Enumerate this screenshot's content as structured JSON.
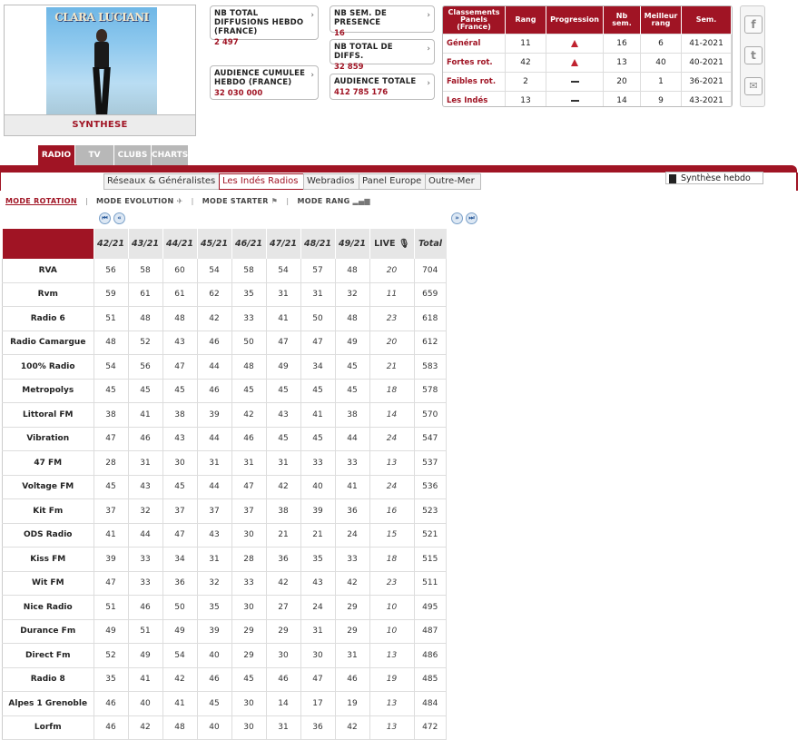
{
  "cover": {
    "artist_text": "CLARA LUCIANI",
    "synthese_label": "SYNTHESE"
  },
  "stats": {
    "nb_total_diffusions": {
      "label": "NB TOTAL DIFFUSIONS HEBDO (FRANCE)",
      "value": "2 497"
    },
    "nb_sem_presence": {
      "label": "NB SEM. DE PRESENCE",
      "value": "16"
    },
    "nb_total_diffs": {
      "label": "NB TOTAL DE DIFFS.",
      "value": "32 859"
    },
    "audience_cumulee": {
      "label": "AUDIENCE CUMULEE HEBDO (FRANCE)",
      "value": "32 030 000"
    },
    "audience_totale": {
      "label": "AUDIENCE TOTALE",
      "value": "412 785 176"
    }
  },
  "classements": {
    "headers": [
      "Classements Panels (France)",
      "Rang",
      "Progression",
      "Nb sem.",
      "Meilleur rang",
      "Sem."
    ],
    "rows": [
      {
        "label": "Général",
        "rang": "11",
        "progression": "up",
        "nb_sem": "16",
        "meilleur": "6",
        "sem": "41-2021"
      },
      {
        "label": "Fortes rot.",
        "rang": "42",
        "progression": "up",
        "nb_sem": "13",
        "meilleur": "40",
        "sem": "40-2021"
      },
      {
        "label": "Faibles rot.",
        "rang": "2",
        "progression": "flat",
        "nb_sem": "20",
        "meilleur": "1",
        "sem": "36-2021"
      },
      {
        "label": "Les Indés",
        "rang": "13",
        "progression": "flat",
        "nb_sem": "14",
        "meilleur": "9",
        "sem": "43-2021"
      }
    ]
  },
  "social": [
    {
      "icon": "facebook-icon",
      "glyph": "f"
    },
    {
      "icon": "twitter-icon",
      "glyph": "t"
    },
    {
      "icon": "mail-icon",
      "glyph": "✉"
    }
  ],
  "media_tabs": [
    "RADIO",
    "TV",
    "CLUBS",
    "CHARTS"
  ],
  "sub_tabs": [
    "Réseaux & Généralistes",
    "Les Indés Radios",
    "Webradios",
    "Panel Europe",
    "Outre-Mer"
  ],
  "synthese_hebdo": "Synthèse hebdo",
  "modes": {
    "rotation": "MODE ROTATION",
    "evolution": "MODE EVOLUTION",
    "starter": "MODE STARTER",
    "rang": "MODE RANG"
  },
  "grid": {
    "columns": [
      "42/21",
      "43/21",
      "44/21",
      "45/21",
      "46/21",
      "47/21",
      "48/21",
      "49/21",
      "LIVE",
      "Total"
    ],
    "rows": [
      {
        "name": "RVA",
        "values": [
          "56",
          "58",
          "60",
          "54",
          "58",
          "54",
          "57",
          "48",
          "20",
          "704"
        ]
      },
      {
        "name": "Rvm",
        "values": [
          "59",
          "61",
          "61",
          "62",
          "35",
          "31",
          "31",
          "32",
          "11",
          "659"
        ]
      },
      {
        "name": "Radio 6",
        "values": [
          "51",
          "48",
          "48",
          "42",
          "33",
          "41",
          "50",
          "48",
          "23",
          "618"
        ]
      },
      {
        "name": "Radio Camargue",
        "values": [
          "48",
          "52",
          "43",
          "46",
          "50",
          "47",
          "47",
          "49",
          "20",
          "612"
        ]
      },
      {
        "name": "100% Radio",
        "values": [
          "54",
          "56",
          "47",
          "44",
          "48",
          "49",
          "34",
          "45",
          "21",
          "583"
        ]
      },
      {
        "name": "Metropolys",
        "values": [
          "45",
          "45",
          "45",
          "46",
          "45",
          "45",
          "45",
          "45",
          "18",
          "578"
        ]
      },
      {
        "name": "Littoral FM",
        "values": [
          "38",
          "41",
          "38",
          "39",
          "42",
          "43",
          "41",
          "38",
          "14",
          "570"
        ]
      },
      {
        "name": "Vibration",
        "values": [
          "47",
          "46",
          "43",
          "44",
          "46",
          "45",
          "45",
          "44",
          "24",
          "547"
        ]
      },
      {
        "name": "47 FM",
        "values": [
          "28",
          "31",
          "30",
          "31",
          "31",
          "31",
          "33",
          "33",
          "13",
          "537"
        ]
      },
      {
        "name": "Voltage FM",
        "values": [
          "45",
          "43",
          "45",
          "44",
          "47",
          "42",
          "40",
          "41",
          "24",
          "536"
        ]
      },
      {
        "name": "Kit Fm",
        "values": [
          "37",
          "32",
          "37",
          "37",
          "37",
          "38",
          "39",
          "36",
          "16",
          "523"
        ]
      },
      {
        "name": "ODS Radio",
        "values": [
          "41",
          "44",
          "47",
          "43",
          "30",
          "21",
          "21",
          "24",
          "15",
          "521"
        ]
      },
      {
        "name": "Kiss FM",
        "values": [
          "39",
          "33",
          "34",
          "31",
          "28",
          "36",
          "35",
          "33",
          "18",
          "515"
        ]
      },
      {
        "name": "Wit FM",
        "values": [
          "47",
          "33",
          "36",
          "32",
          "33",
          "42",
          "43",
          "42",
          "23",
          "511"
        ]
      },
      {
        "name": "Nice Radio",
        "values": [
          "51",
          "46",
          "50",
          "35",
          "30",
          "27",
          "24",
          "29",
          "10",
          "495"
        ]
      },
      {
        "name": "Durance Fm",
        "values": [
          "49",
          "51",
          "49",
          "39",
          "29",
          "29",
          "31",
          "29",
          "10",
          "487"
        ]
      },
      {
        "name": "Direct Fm",
        "values": [
          "52",
          "49",
          "54",
          "40",
          "29",
          "30",
          "30",
          "31",
          "13",
          "486"
        ]
      },
      {
        "name": "Radio 8",
        "values": [
          "35",
          "41",
          "42",
          "46",
          "45",
          "46",
          "47",
          "46",
          "19",
          "485"
        ]
      },
      {
        "name": "Alpes 1 Grenoble",
        "values": [
          "46",
          "40",
          "41",
          "45",
          "30",
          "14",
          "17",
          "19",
          "13",
          "484"
        ]
      },
      {
        "name": "Lorfm",
        "values": [
          "46",
          "42",
          "48",
          "40",
          "30",
          "31",
          "36",
          "42",
          "13",
          "472"
        ]
      }
    ]
  }
}
